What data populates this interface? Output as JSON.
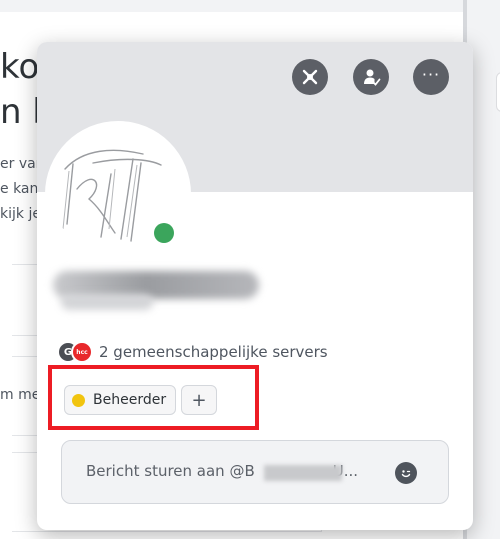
{
  "background": {
    "heading_line1": "kom bij",
    "heading_line2": "n het",
    "text_line1": "er van",
    "text_line2": "e kan",
    "text_line3": "kijk je",
    "box_text": "m meer"
  },
  "popout": {
    "actions": [
      {
        "name": "no-mic-icon"
      },
      {
        "name": "add-person-icon"
      },
      {
        "name": "more-icon",
        "label": "···"
      }
    ],
    "status": {
      "color": "#3ba55c"
    },
    "mutual_servers": {
      "icons": [
        {
          "name": "server-icon-1",
          "text": "G"
        },
        {
          "name": "server-icon-2",
          "text": "hcc"
        }
      ],
      "label": "2 gemeenschappelijke servers"
    },
    "roles": [
      {
        "label": "Beheerder",
        "color": "#f1c40f"
      }
    ],
    "add_role_label": "+",
    "message": {
      "placeholder_prefix": "Bericht sturen aan @B",
      "placeholder_suffix": "U...",
      "emoji_icon": "smile-icon"
    },
    "highlight_color": "#ed1c24"
  }
}
